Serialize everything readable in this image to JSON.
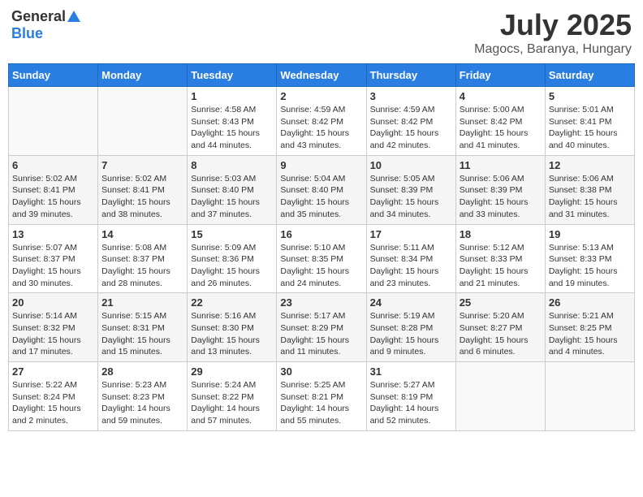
{
  "header": {
    "logo_general": "General",
    "logo_blue": "Blue",
    "month_title": "July 2025",
    "location": "Magocs, Baranya, Hungary"
  },
  "weekdays": [
    "Sunday",
    "Monday",
    "Tuesday",
    "Wednesday",
    "Thursday",
    "Friday",
    "Saturday"
  ],
  "weeks": [
    [
      {
        "day": "",
        "detail": ""
      },
      {
        "day": "",
        "detail": ""
      },
      {
        "day": "1",
        "detail": "Sunrise: 4:58 AM\nSunset: 8:43 PM\nDaylight: 15 hours\nand 44 minutes."
      },
      {
        "day": "2",
        "detail": "Sunrise: 4:59 AM\nSunset: 8:42 PM\nDaylight: 15 hours\nand 43 minutes."
      },
      {
        "day": "3",
        "detail": "Sunrise: 4:59 AM\nSunset: 8:42 PM\nDaylight: 15 hours\nand 42 minutes."
      },
      {
        "day": "4",
        "detail": "Sunrise: 5:00 AM\nSunset: 8:42 PM\nDaylight: 15 hours\nand 41 minutes."
      },
      {
        "day": "5",
        "detail": "Sunrise: 5:01 AM\nSunset: 8:41 PM\nDaylight: 15 hours\nand 40 minutes."
      }
    ],
    [
      {
        "day": "6",
        "detail": "Sunrise: 5:02 AM\nSunset: 8:41 PM\nDaylight: 15 hours\nand 39 minutes."
      },
      {
        "day": "7",
        "detail": "Sunrise: 5:02 AM\nSunset: 8:41 PM\nDaylight: 15 hours\nand 38 minutes."
      },
      {
        "day": "8",
        "detail": "Sunrise: 5:03 AM\nSunset: 8:40 PM\nDaylight: 15 hours\nand 37 minutes."
      },
      {
        "day": "9",
        "detail": "Sunrise: 5:04 AM\nSunset: 8:40 PM\nDaylight: 15 hours\nand 35 minutes."
      },
      {
        "day": "10",
        "detail": "Sunrise: 5:05 AM\nSunset: 8:39 PM\nDaylight: 15 hours\nand 34 minutes."
      },
      {
        "day": "11",
        "detail": "Sunrise: 5:06 AM\nSunset: 8:39 PM\nDaylight: 15 hours\nand 33 minutes."
      },
      {
        "day": "12",
        "detail": "Sunrise: 5:06 AM\nSunset: 8:38 PM\nDaylight: 15 hours\nand 31 minutes."
      }
    ],
    [
      {
        "day": "13",
        "detail": "Sunrise: 5:07 AM\nSunset: 8:37 PM\nDaylight: 15 hours\nand 30 minutes."
      },
      {
        "day": "14",
        "detail": "Sunrise: 5:08 AM\nSunset: 8:37 PM\nDaylight: 15 hours\nand 28 minutes."
      },
      {
        "day": "15",
        "detail": "Sunrise: 5:09 AM\nSunset: 8:36 PM\nDaylight: 15 hours\nand 26 minutes."
      },
      {
        "day": "16",
        "detail": "Sunrise: 5:10 AM\nSunset: 8:35 PM\nDaylight: 15 hours\nand 24 minutes."
      },
      {
        "day": "17",
        "detail": "Sunrise: 5:11 AM\nSunset: 8:34 PM\nDaylight: 15 hours\nand 23 minutes."
      },
      {
        "day": "18",
        "detail": "Sunrise: 5:12 AM\nSunset: 8:33 PM\nDaylight: 15 hours\nand 21 minutes."
      },
      {
        "day": "19",
        "detail": "Sunrise: 5:13 AM\nSunset: 8:33 PM\nDaylight: 15 hours\nand 19 minutes."
      }
    ],
    [
      {
        "day": "20",
        "detail": "Sunrise: 5:14 AM\nSunset: 8:32 PM\nDaylight: 15 hours\nand 17 minutes."
      },
      {
        "day": "21",
        "detail": "Sunrise: 5:15 AM\nSunset: 8:31 PM\nDaylight: 15 hours\nand 15 minutes."
      },
      {
        "day": "22",
        "detail": "Sunrise: 5:16 AM\nSunset: 8:30 PM\nDaylight: 15 hours\nand 13 minutes."
      },
      {
        "day": "23",
        "detail": "Sunrise: 5:17 AM\nSunset: 8:29 PM\nDaylight: 15 hours\nand 11 minutes."
      },
      {
        "day": "24",
        "detail": "Sunrise: 5:19 AM\nSunset: 8:28 PM\nDaylight: 15 hours\nand 9 minutes."
      },
      {
        "day": "25",
        "detail": "Sunrise: 5:20 AM\nSunset: 8:27 PM\nDaylight: 15 hours\nand 6 minutes."
      },
      {
        "day": "26",
        "detail": "Sunrise: 5:21 AM\nSunset: 8:25 PM\nDaylight: 15 hours\nand 4 minutes."
      }
    ],
    [
      {
        "day": "27",
        "detail": "Sunrise: 5:22 AM\nSunset: 8:24 PM\nDaylight: 15 hours\nand 2 minutes."
      },
      {
        "day": "28",
        "detail": "Sunrise: 5:23 AM\nSunset: 8:23 PM\nDaylight: 14 hours\nand 59 minutes."
      },
      {
        "day": "29",
        "detail": "Sunrise: 5:24 AM\nSunset: 8:22 PM\nDaylight: 14 hours\nand 57 minutes."
      },
      {
        "day": "30",
        "detail": "Sunrise: 5:25 AM\nSunset: 8:21 PM\nDaylight: 14 hours\nand 55 minutes."
      },
      {
        "day": "31",
        "detail": "Sunrise: 5:27 AM\nSunset: 8:19 PM\nDaylight: 14 hours\nand 52 minutes."
      },
      {
        "day": "",
        "detail": ""
      },
      {
        "day": "",
        "detail": ""
      }
    ]
  ]
}
